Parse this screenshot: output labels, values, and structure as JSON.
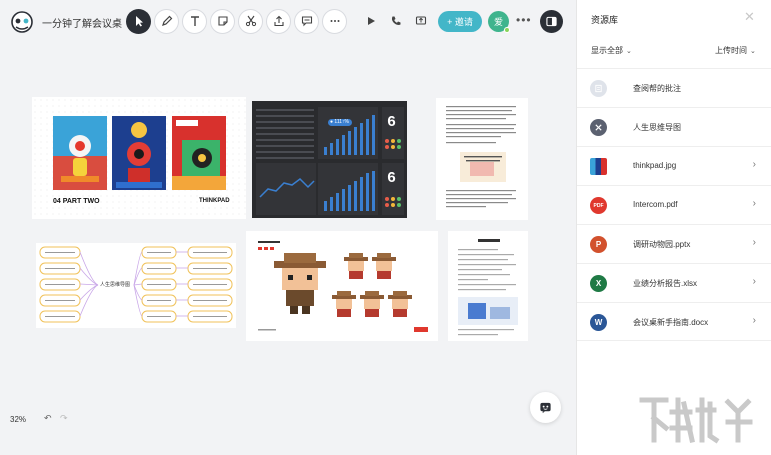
{
  "header": {
    "title": "一分钟了解会议桌",
    "invite_label": "+ 邀请",
    "avatar_initial": "爱",
    "more_glyph": "•••"
  },
  "toolbar": {
    "tools": [
      "select-icon",
      "pen-icon",
      "text-icon",
      "sticky-note-icon",
      "cut-icon",
      "upload-icon",
      "comment-icon",
      "more-icon"
    ],
    "actions": [
      "play-icon",
      "phone-icon",
      "share-screen-icon"
    ]
  },
  "canvas": {
    "zoom": "32%",
    "card1": {
      "label_left": "04  PART TWO",
      "label_right": "THINKPAD"
    },
    "card2": {
      "kpi_top": "6",
      "kpi_bottom": "6",
      "badge": "● 111↑%"
    },
    "card4": {
      "center": "人生思维导图"
    }
  },
  "panel": {
    "title": "资源库",
    "filter_left": "显示全部",
    "filter_right": "上传时间",
    "items": [
      {
        "name": "查阅帮的批注",
        "icon": "annotation-icon",
        "color": "#dfe3ea",
        "glyph": "",
        "chevron": ""
      },
      {
        "name": "人生思维导图",
        "icon": "mindmap-icon",
        "color": "#5b6170",
        "glyph": "",
        "chevron": ""
      },
      {
        "name": "thinkpad.jpg",
        "icon": "image-icon",
        "color": "#2c2f3a",
        "glyph": "",
        "chevron": "›"
      },
      {
        "name": "Intercom.pdf",
        "icon": "pdf-icon",
        "color": "#e0382e",
        "glyph": "PDF",
        "chevron": "›"
      },
      {
        "name": "调研动物园.pptx",
        "icon": "pptx-icon",
        "color": "#d2512d",
        "glyph": "P",
        "chevron": "›"
      },
      {
        "name": "业绩分析报告.xlsx",
        "icon": "xlsx-icon",
        "color": "#1f7a45",
        "glyph": "X",
        "chevron": "›"
      },
      {
        "name": "会议桌新手指南.docx",
        "icon": "docx-icon",
        "color": "#2b5797",
        "glyph": "W",
        "chevron": "›"
      }
    ]
  },
  "colors": {
    "accent": "#43b6c8",
    "dark": "#2b2f36"
  }
}
